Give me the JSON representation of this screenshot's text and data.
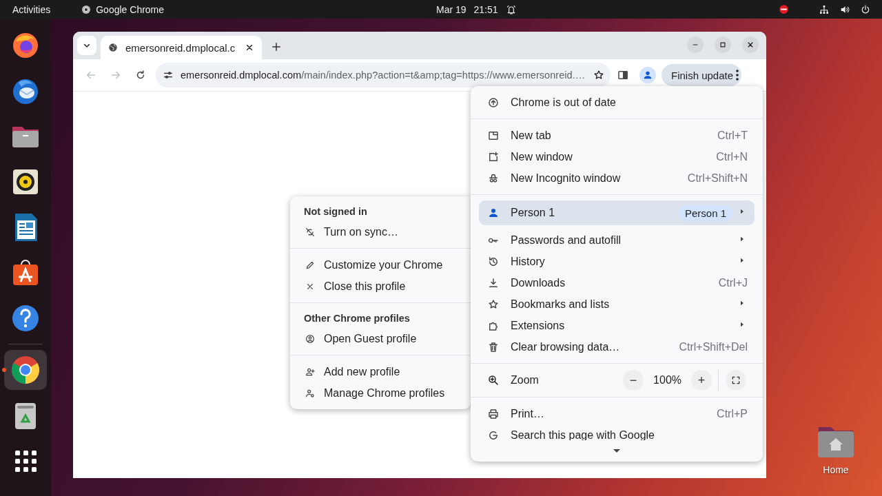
{
  "top_bar": {
    "activities": "Activities",
    "app_name": "Google Chrome",
    "date": "Mar 19",
    "time": "21:51"
  },
  "dock": {
    "items": [
      {
        "selected": false,
        "running": false
      },
      {
        "selected": false,
        "running": false
      },
      {
        "selected": false,
        "running": false
      },
      {
        "selected": false,
        "running": false
      },
      {
        "selected": false,
        "running": false
      },
      {
        "selected": false,
        "running": false
      },
      {
        "selected": false,
        "running": false
      },
      {
        "selected": true,
        "running": true
      },
      {
        "selected": false,
        "running": false
      },
      {
        "selected": false,
        "running": false
      }
    ]
  },
  "browser": {
    "tabs": [
      {
        "title": "emersonreid.dmplocal.c",
        "selected": true
      }
    ],
    "back_disabled": true,
    "forward_disabled": true,
    "url": {
      "host": "emersonreid.dmplocal.com",
      "path": "/main/index.php?action=t&amp;tag=https://www.emersonreid.…"
    },
    "update_button": "Finish update"
  },
  "menu": {
    "sections": [
      {
        "items": [
          {
            "label": "Chrome is out of date",
            "highlighted": false,
            "submenu": false
          }
        ]
      },
      {
        "items": [
          {
            "label": "New tab",
            "shortcut": "Ctrl+T",
            "highlighted": false,
            "submenu": false
          },
          {
            "label": "New window",
            "shortcut": "Ctrl+N",
            "highlighted": false,
            "submenu": false
          },
          {
            "label": "New Incognito window",
            "shortcut": "Ctrl+Shift+N",
            "highlighted": false,
            "submenu": false
          }
        ]
      },
      {
        "items": [
          {
            "label": "Person 1",
            "chip": "Person 1",
            "highlighted": true,
            "submenu": true
          },
          {
            "label": "Passwords and autofill",
            "highlighted": false,
            "submenu": true
          },
          {
            "label": "History",
            "highlighted": false,
            "submenu": true
          },
          {
            "label": "Downloads",
            "shortcut": "Ctrl+J",
            "highlighted": false,
            "submenu": false
          },
          {
            "label": "Bookmarks and lists",
            "highlighted": false,
            "submenu": true
          },
          {
            "label": "Extensions",
            "highlighted": false,
            "submenu": true
          },
          {
            "label": "Clear browsing data…",
            "shortcut": "Ctrl+Shift+Del",
            "highlighted": false,
            "submenu": false
          }
        ]
      },
      {
        "zoom": {
          "label": "Zoom",
          "minus": "−",
          "value": "100%",
          "plus": "+"
        }
      },
      {
        "items": [
          {
            "label": "Print…",
            "shortcut": "Ctrl+P",
            "highlighted": false,
            "submenu": false
          },
          {
            "label": "Search this page with Google",
            "highlighted": false,
            "submenu": false
          }
        ]
      }
    ]
  },
  "profile_menu": {
    "sections": [
      {
        "heading": "Not signed in",
        "items": [
          {
            "label": "Turn on sync…"
          }
        ]
      },
      {
        "items": [
          {
            "label": "Customize your Chrome"
          },
          {
            "label": "Close this profile"
          }
        ]
      },
      {
        "heading": "Other Chrome profiles",
        "items": [
          {
            "label": "Open Guest profile"
          }
        ]
      },
      {
        "items": [
          {
            "label": "Add new profile"
          },
          {
            "label": "Manage Chrome profiles"
          }
        ]
      }
    ]
  },
  "desktop": {
    "icons": [
      {
        "label": "Home"
      }
    ]
  }
}
